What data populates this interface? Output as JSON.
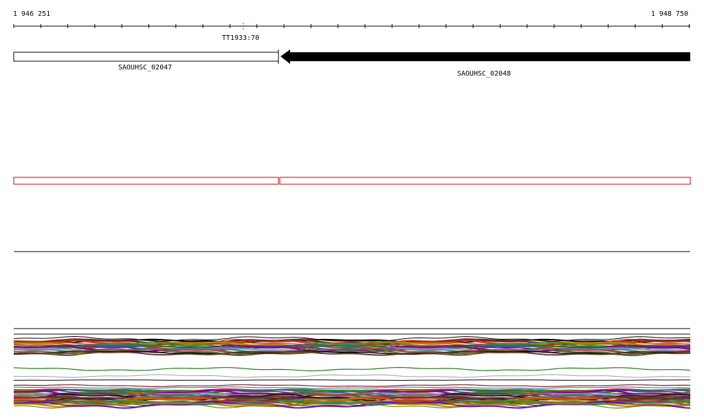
{
  "coordinates": {
    "start_label": "1 946 251",
    "end_label": "1 948 750"
  },
  "terminator": {
    "label": "TT1933:70"
  },
  "genes": [
    {
      "label": "SAOUHSC_02047",
      "strand": "forward",
      "fill": "#ffffff"
    },
    {
      "label": "SAOUHSC_02048",
      "strand": "reverse",
      "fill": "#000000"
    }
  ],
  "colors": {
    "axis": "#000000",
    "feature_box_outline": "#cc0000",
    "track_palette": [
      "#000000",
      "#5a3a2a",
      "#7a1f1f",
      "#c0392b",
      "#d35400",
      "#b8860b",
      "#808000",
      "#2e8b57",
      "#1e7b1e",
      "#3b5ba5",
      "#6a0dad",
      "#8b008b",
      "#a0a0a0",
      "#4682b4",
      "#a0522d",
      "#556b2f"
    ]
  }
}
